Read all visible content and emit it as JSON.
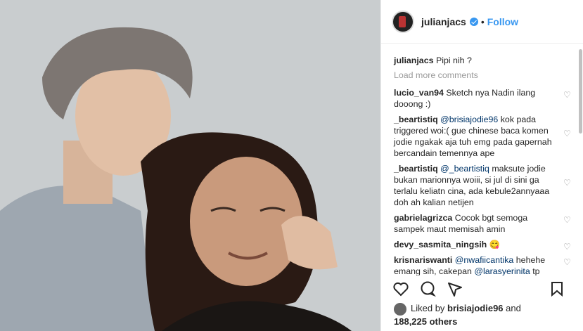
{
  "header": {
    "username": "julianjacs",
    "separator": "•",
    "follow_label": "Follow"
  },
  "caption": {
    "username": "julianjacs",
    "text": "Pipi nih ?"
  },
  "load_more_label": "Load more comments",
  "comments": [
    {
      "user": "lucio_van94",
      "parts": [
        "Sketch nya Nadin ilang dooong :)"
      ]
    },
    {
      "user": "_beartistiq",
      "mention": "@brisiajodie96",
      "parts": [
        "kok pada triggered woi:( gue chinese baca komen jodie ngakak aja tuh emg pada gapernah bercandain temennya ape"
      ]
    },
    {
      "user": "_beartistiq",
      "mention": "@_beartistiq",
      "parts": [
        "maksute jodie bukan marionnya woiii, si jul di sini ga terlalu keliatn cina, ada kebule2annyaaa doh ah kalian netijen"
      ]
    },
    {
      "user": "gabrielagrizca",
      "parts": [
        "Cocok bgt semoga sampek maut memisah amin"
      ]
    },
    {
      "user": "devy_sasmita_ningsih",
      "parts": [
        "😋"
      ]
    },
    {
      "user": "krisnariswanti",
      "mention": "@nwafiicantika",
      "parts": [
        "hehehe emang sih, cakepan"
      ],
      "mention2": "@larasyerinita",
      "tail": "tp"
    }
  ],
  "likes": {
    "liked_by": "Liked by",
    "user": "brisiajodie96",
    "and": "and",
    "count": "188,225 others"
  },
  "icons": [
    "heart-icon",
    "comment-icon",
    "share-icon",
    "save-icon"
  ]
}
